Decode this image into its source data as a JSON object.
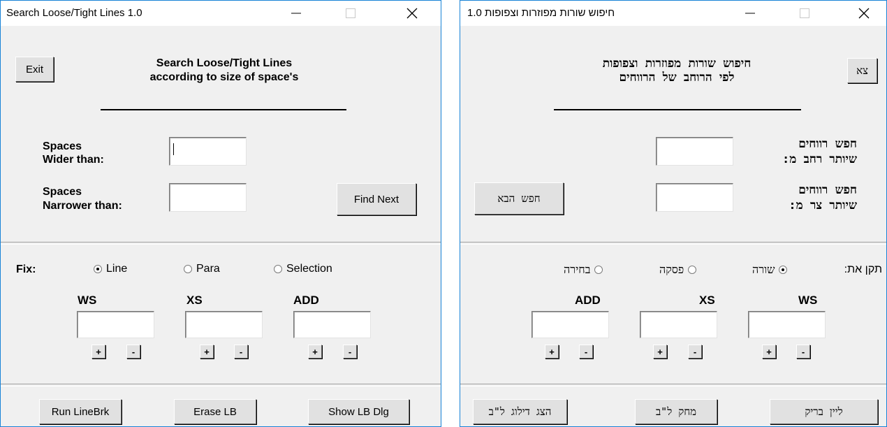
{
  "left": {
    "title": "Search Loose/Tight Lines   1.0",
    "exit": "Exit",
    "heading1": "Search Loose/Tight Lines",
    "heading2": "according to size of space's",
    "wider1": "Spaces",
    "wider2": "Wider than:",
    "narrower1": "Spaces",
    "narrower2": "Narrower than:",
    "find_next": "Find Next",
    "fix": "Fix:",
    "radio_line": "Line",
    "radio_para": "Para",
    "radio_selection": "Selection",
    "selected": "Line",
    "col_ws": "WS",
    "col_xs": "XS",
    "col_add": "ADD",
    "plus": "+",
    "minus": "-",
    "run": "Run LineBrk",
    "erase": "Erase LB",
    "show": "Show LB Dlg"
  },
  "right": {
    "title": "חיפוש שורות מפוזרות וצפופות  1.0",
    "exit": "צא",
    "heading1": "חיפוש שורות מפוזרות וצפופות",
    "heading2": "לפי הרוחב של הרווחים",
    "wider1": "חפש רווחים",
    "wider2": "שיותר רחב מ:",
    "narrower1": "חפש רווחים",
    "narrower2": "שיותר צר מ:",
    "find_next": "חפש הבא",
    "fix": "תקן את:",
    "radio_line": "שורה",
    "radio_para": "פסקה",
    "radio_selection": "בחירה",
    "selected": "שורה",
    "col_ws": "WS",
    "col_xs": "XS",
    "col_add": "ADD",
    "plus": "+",
    "minus": "-",
    "run": "ליין בריק",
    "erase": "מחק ל\"ב",
    "show": "הצג דילוג ל\"ב"
  }
}
